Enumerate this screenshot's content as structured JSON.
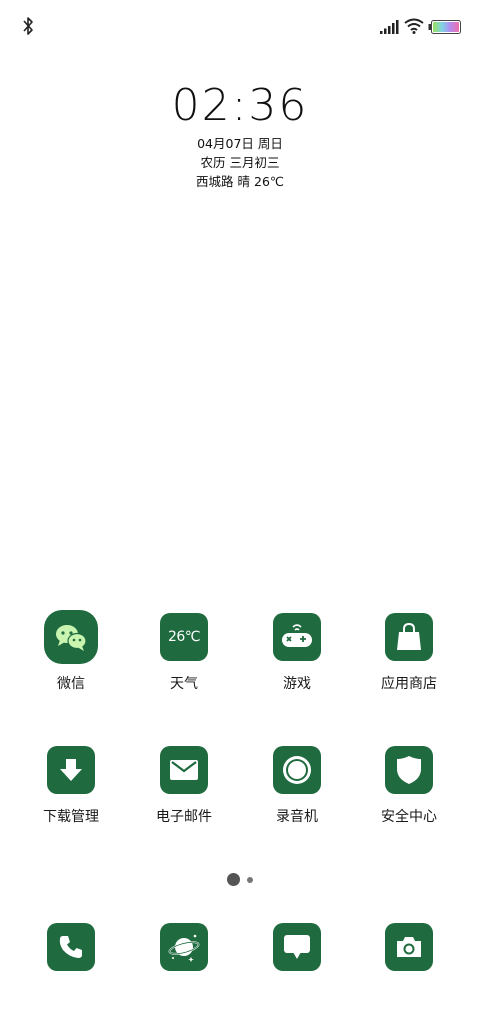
{
  "status_bar": {
    "icons": [
      "bluetooth-icon",
      "signal-icon",
      "wifi-icon",
      "battery-icon"
    ]
  },
  "clock": {
    "time": "02:36",
    "date": "04月07日 周日",
    "lunar": "农历 三月初三",
    "weather": "西城路 晴 26℃"
  },
  "apps": {
    "row1": [
      {
        "label": "微信",
        "icon": "wechat-icon"
      },
      {
        "label": "天气",
        "icon": "weather-icon",
        "tile_text": "26℃"
      },
      {
        "label": "游戏",
        "icon": "gamepad-icon"
      },
      {
        "label": "应用商店",
        "icon": "shopping-bag-icon"
      }
    ],
    "row2": [
      {
        "label": "下载管理",
        "icon": "download-icon"
      },
      {
        "label": "电子邮件",
        "icon": "mail-icon"
      },
      {
        "label": "录音机",
        "icon": "recorder-icon"
      },
      {
        "label": "安全中心",
        "icon": "shield-icon"
      }
    ]
  },
  "page_indicator": {
    "pages": 2,
    "current": 1
  },
  "dock": [
    {
      "icon": "phone-icon"
    },
    {
      "icon": "browser-planet-icon"
    },
    {
      "icon": "message-icon"
    },
    {
      "icon": "camera-icon"
    }
  ],
  "colors": {
    "tile": "#1f6b3f",
    "wechat_bubble": "#c9f5b0"
  }
}
